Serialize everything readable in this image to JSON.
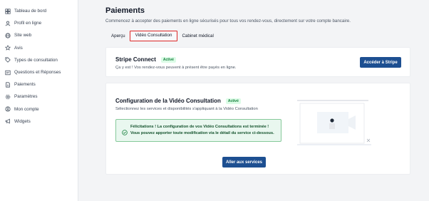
{
  "sidebar": {
    "items": [
      {
        "label": "Tableau de bord",
        "icon": "dashboard-icon"
      },
      {
        "label": "Profil en ligne",
        "icon": "user-icon"
      },
      {
        "label": "Site web",
        "icon": "globe-icon"
      },
      {
        "label": "Avis",
        "icon": "star-icon"
      },
      {
        "label": "Types de consultation",
        "icon": "tag-icon"
      },
      {
        "label": "Questions et Réponses",
        "icon": "qa-icon"
      },
      {
        "label": "Paiements",
        "icon": "document-icon"
      },
      {
        "label": "Paramètres",
        "icon": "gear-icon"
      },
      {
        "label": "Mon compte",
        "icon": "account-icon"
      },
      {
        "label": "Widgets",
        "icon": "megaphone-icon"
      }
    ]
  },
  "header": {
    "title": "Paiements",
    "subtitle": "Commencez à accepter des paiements en ligne sécurisés pour tous vos rendez-vous, directement sur votre compte bancaire."
  },
  "tabs": [
    {
      "label": "Aperçu",
      "active": false
    },
    {
      "label": "Vidéo Consultation",
      "active": true
    },
    {
      "label": "Cabinet médical",
      "active": false
    }
  ],
  "stripe": {
    "title": "Stripe Connect",
    "badge": "Activé",
    "description": "Ça y est ! Vos rendez-vous peuvent à présent être payés en ligne.",
    "button": "Accéder à Stripe"
  },
  "video": {
    "title": "Configuration de la Vidéo Consultation",
    "badge": "Activé",
    "description": "Sélectionnez les services et disponibilités s'appliquant à la Vidéo Consultation",
    "success_line1": "Félicitations ! La configuration de vos Vidéo Consultations est terminée !",
    "success_line2": "Vous pouvez apporter toute modification via le détail du service ci-dessous.",
    "button": "Aller aux services"
  },
  "colors": {
    "accent": "#1d4f91",
    "success": "#15803d",
    "active_tab_border": "#dc2626"
  }
}
